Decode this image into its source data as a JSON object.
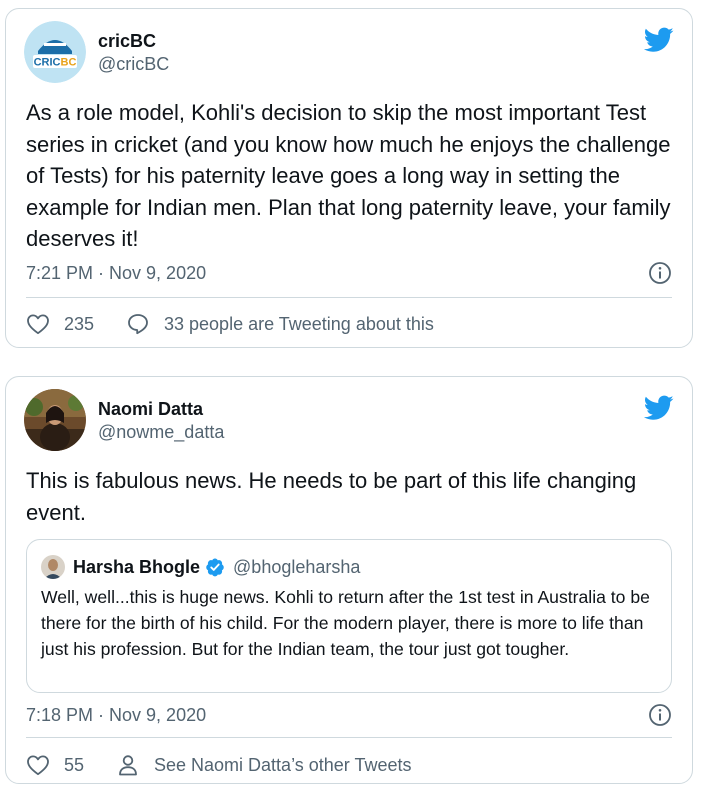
{
  "tweets": [
    {
      "author": {
        "display_name": "cricBC",
        "handle": "@cricBC",
        "avatar_text": "CRICBC"
      },
      "text": "As a role model, Kohli's decision to skip the most important Test series in cricket (and you know how much he enjoys the challenge of Tests) for his paternity leave goes a long way in setting the example for Indian men. Plan that long paternity leave, your family deserves it!",
      "timestamp": "7:21 PM · Nov 9, 2020",
      "likes": "235",
      "secondary_action": "33 people are Tweeting about this",
      "secondary_icon": "reply-bubble-icon"
    },
    {
      "author": {
        "display_name": "Naomi Datta",
        "handle": "@nowme_datta"
      },
      "text": "This is fabulous news. He needs to be part of this life changing event.",
      "quoted": {
        "display_name": "Harsha Bhogle",
        "handle": "@bhogleharsha",
        "verified": true,
        "text": "Well, well...this is huge news. Kohli to return after the 1st test in Australia to be there for the birth of his child. For the modern player, there is more to life than just his profession. But for the Indian team, the tour just got tougher."
      },
      "timestamp": "7:18 PM · Nov 9, 2020",
      "likes": "55",
      "secondary_action": "See Naomi Datta’s other Tweets",
      "secondary_icon": "person-icon"
    }
  ],
  "colors": {
    "twitter_blue": "#1d9bf0",
    "text": "#0f1419",
    "secondary": "#536471",
    "border": "#cfd9de"
  }
}
